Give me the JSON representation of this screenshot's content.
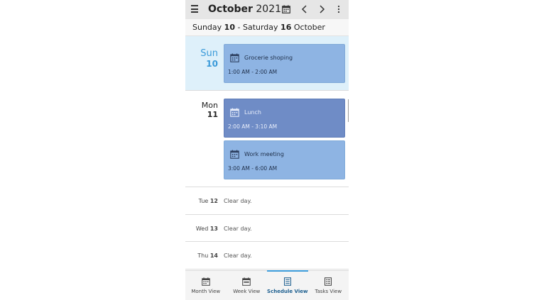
{
  "header": {
    "month": "October",
    "year": "2021",
    "icons": [
      "menu-icon",
      "calendar-icon",
      "chevron-left-icon",
      "chevron-right-icon",
      "more-vertical-icon"
    ]
  },
  "range": {
    "start_day": "Sunday",
    "start_num": "10",
    "separator": "-",
    "end_day": "Saturday",
    "end_num": "16",
    "end_month": "October"
  },
  "days": [
    {
      "name": "Sun",
      "num": "10",
      "events": [
        {
          "title": "Grocerie shoping",
          "time": "1:00 AM - 2:00 AM"
        }
      ]
    },
    {
      "name": "Mon",
      "num": "11",
      "events": [
        {
          "title": "Lunch",
          "time": "2:00 AM - 3:10 AM"
        },
        {
          "title": "Work meeting",
          "time": "3:00 AM - 6:00 AM"
        }
      ]
    }
  ],
  "clear_days": [
    {
      "name": "Tue",
      "num": "12",
      "text": "Clear day."
    },
    {
      "name": "Wed",
      "num": "13",
      "text": "Clear day."
    },
    {
      "name": "Thu",
      "num": "14",
      "text": "Clear day."
    }
  ],
  "nav": [
    {
      "label": "Month View",
      "icon": "month-view-icon"
    },
    {
      "label": "Week View",
      "icon": "week-view-icon"
    },
    {
      "label": "Schedule View",
      "icon": "schedule-view-icon",
      "active": true
    },
    {
      "label": "Tasks View",
      "icon": "tasks-view-icon"
    }
  ],
  "colors": {
    "header_bg": "#e6e6e6",
    "today_bg": "#def0fa",
    "accent": "#3a9ad9",
    "event_light": "#8eb4e3",
    "event_dark": "#6f8cc6"
  }
}
